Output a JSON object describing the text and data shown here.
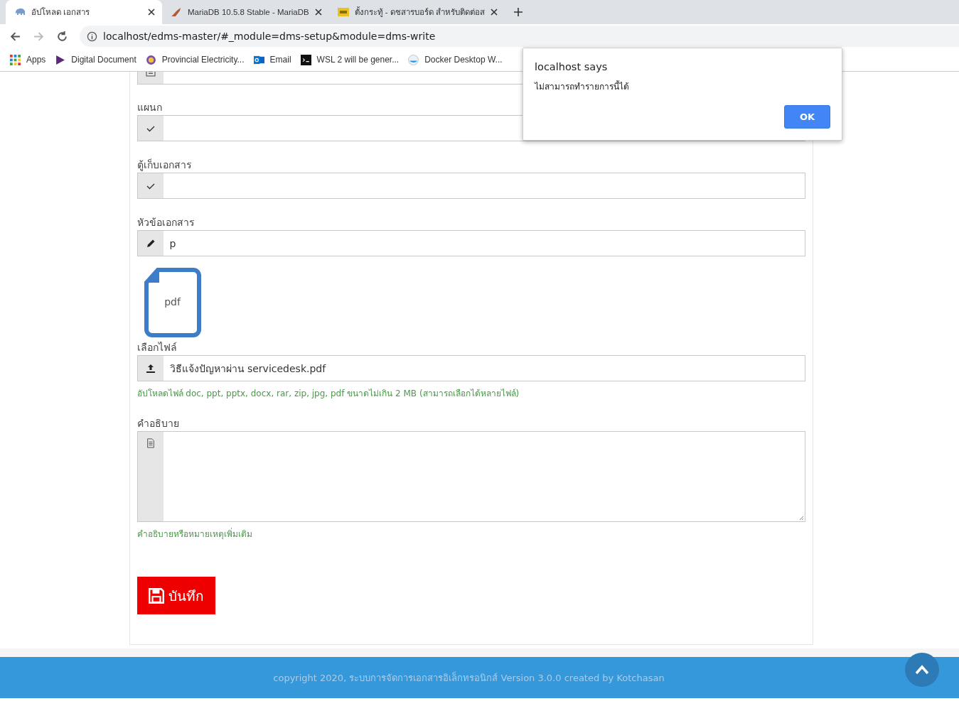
{
  "browser": {
    "tabs": [
      {
        "title": "อัปโหลด เอกสาร",
        "selected": true
      },
      {
        "title": "MariaDB 10.5.8 Stable - MariaDB",
        "selected": false
      },
      {
        "title": "ตั้งกระทู้ - ดชสารบอร์ด สำหรับติดต่อส",
        "selected": false
      }
    ],
    "url": "localhost/edms-master/#_module=dms-setup&module=dms-write",
    "bookmarks": [
      {
        "label": "Apps"
      },
      {
        "label": "Digital Document"
      },
      {
        "label": "Provincial Electricity..."
      },
      {
        "label": "Email"
      },
      {
        "label": "WSL 2 will be gener..."
      },
      {
        "label": "Docker Desktop W..."
      }
    ]
  },
  "form": {
    "items": [
      {
        "kind": "date"
      },
      {
        "kind": "select",
        "label": "แผนก"
      },
      {
        "kind": "select",
        "label": "ตู้เก็บเอกสาร"
      },
      {
        "kind": "text",
        "label": "หัวข้อเอกสาร",
        "value": "p"
      },
      {
        "kind": "preview",
        "file_type": "pdf"
      },
      {
        "kind": "file",
        "label": "เลือกไฟล์",
        "value": "วิธีแจ้งปัญหาผ่าน servicedesk.pdf",
        "help": "อัปโหลดไฟล์ doc, ppt, pptx, docx, rar, zip, jpg, pdf ขนาดไม่เกิน 2 MB (สามารถเลือกได้หลายไฟล์)"
      },
      {
        "kind": "textarea",
        "label": "คำอธิบาย",
        "help": "คำอธิบายหรือหมายเหตุเพิ่มเติม"
      }
    ],
    "save_button": "บันทึก"
  },
  "dialog": {
    "title": "localhost says",
    "message": "ไม่สามารถทำรายการนี้ได้",
    "button": "OK"
  },
  "footer": {
    "text": "copyright 2020, ระบบการจัดการเอกสารอิเล็กทรอนิกส์ Version 3.0.0 created by Kotchasan"
  }
}
